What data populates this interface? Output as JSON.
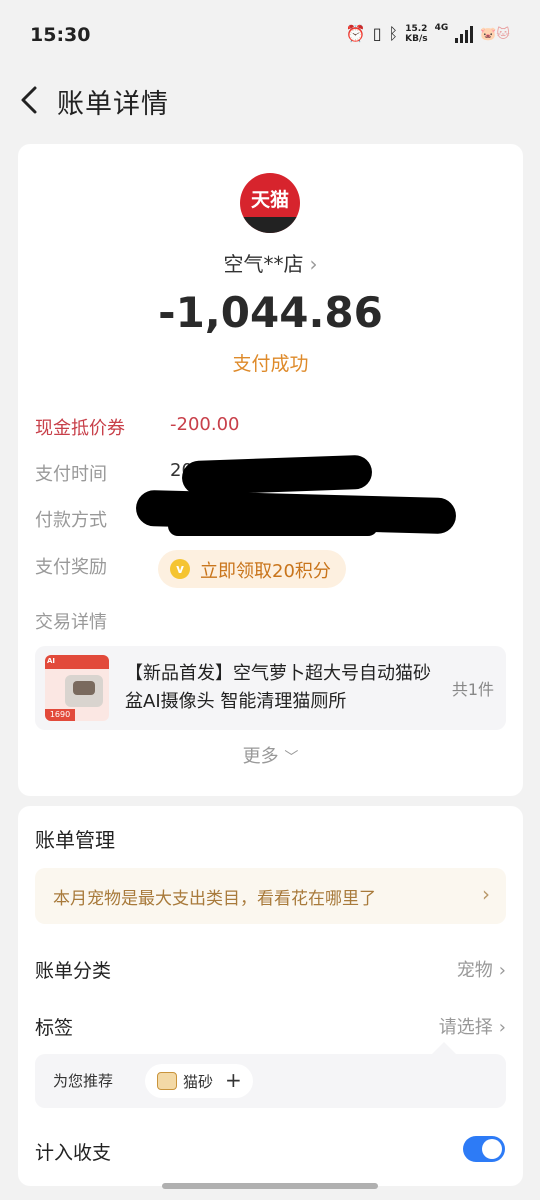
{
  "status_bar": {
    "time": "15:30",
    "net_speed_value": "15.2",
    "net_speed_unit": "KB/s",
    "network_type": "4G",
    "icons": [
      "alarm-icon",
      "vibrate-icon",
      "bluetooth-icon",
      "signal-icon",
      "pet-emoji-icon"
    ]
  },
  "nav": {
    "title": "账单详情",
    "back_icon": "chevron-left-icon"
  },
  "transaction": {
    "merchant_logo_text": "天猫",
    "merchant_name": "空气**店",
    "amount": "-1,044.86",
    "status": "支付成功",
    "status_color": "#de8a2a"
  },
  "details": {
    "coupon_label": "现金抵价券",
    "coupon_value": "-200.00",
    "pay_time_label": "支付时间",
    "pay_time_value": "20",
    "pay_method_label": "付款方式",
    "reward_label": "支付奖励",
    "reward_button": "立即领取20积分",
    "trade_detail_label": "交易详情",
    "product_title": "【新品首发】空气萝卜超大号自动猫砂盆AI摄像头 智能清理猫厕所",
    "product_count": "共1件",
    "more_label": "更多"
  },
  "management": {
    "title": "账单管理",
    "insight_text": "本月宠物是最大支出类目，看看花在哪里了",
    "category_label": "账单分类",
    "category_value": "宠物",
    "tag_label": "标签",
    "tag_value": "请选择",
    "recommend_label": "为您推荐",
    "recommend_chip": "猫砂",
    "include_label": "计入收支",
    "include_enabled": true
  },
  "colors": {
    "accent_red": "#c8404a",
    "accent_orange": "#de8a2a",
    "toggle_blue": "#2d7bf6",
    "tmall_red": "#d7242d"
  }
}
